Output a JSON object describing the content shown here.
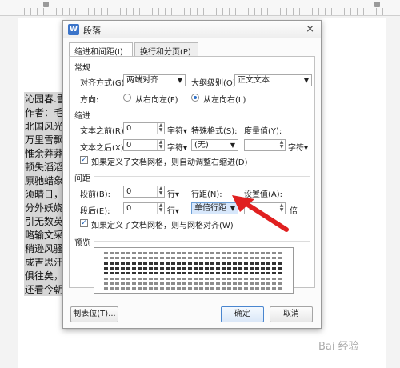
{
  "document": {
    "lines": [
      "沁园春.雪",
      "作者：毛泽",
      "北国风光，",
      "万里雪飘。",
      "惟余莽莽；",
      "顿失滔滔。",
      "原驰蜡象，",
      "须晴日，看",
      "分外妖娆。",
      "引无数英雄",
      "略输文采；",
      "稍逊风骚。",
      "成吉思汗，",
      "俱往矣，数",
      "还看今朝。"
    ]
  },
  "dialog": {
    "title": "段落",
    "close": "×",
    "tabs": [
      {
        "label": "缩进和间距(I)",
        "active": true
      },
      {
        "label": "换行和分页(P)",
        "active": false
      }
    ],
    "general": {
      "header": "常规",
      "align_label": "对齐方式(G):",
      "align_value": "两端对齐",
      "outline_label": "大纲级别(O):",
      "outline_value": "正文文本",
      "direction_label": "方向:",
      "rtl_label": "从右向左(F)",
      "ltr_label": "从左向右(L)",
      "direction_selected": "ltr"
    },
    "indent": {
      "header": "缩进",
      "before_label": "文本之前(R):",
      "before_value": "0",
      "before_unit": "字符",
      "after_label": "文本之后(X):",
      "after_value": "0",
      "after_unit": "字符",
      "special_label": "特殊格式(S):",
      "special_value": "(无)",
      "measure_label": "度量值(Y):",
      "measure_value": "",
      "measure_unit": "字符",
      "grid_check_label": "如果定义了文档网格，则自动调整右缩进(D)",
      "grid_checked": true
    },
    "spacing": {
      "header": "间距",
      "before_label": "段前(B):",
      "before_value": "0",
      "before_unit": "行",
      "after_label": "段后(E):",
      "after_value": "0",
      "after_unit": "行",
      "line_label": "行距(N):",
      "line_value": "单倍行距",
      "setting_label": "设置值(A):",
      "setting_value": "1",
      "setting_unit": "倍",
      "grid_check_label": "如果定义了文档网格，则与网格对齐(W)",
      "grid_checked": true
    },
    "preview_header": "预览",
    "buttons": {
      "tabs": "制表位(T)...",
      "ok": "确定",
      "cancel": "取消"
    }
  },
  "watermark": "Bai 经验"
}
